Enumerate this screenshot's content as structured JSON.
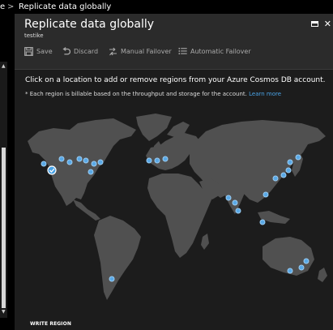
{
  "topbar": {
    "nav_glyph": "e",
    "chevron": ">",
    "breadcrumb": "Replicate data globally"
  },
  "blade": {
    "title": "Replicate data globally",
    "subtitle": "testike",
    "window_icons": [
      "maximize-icon",
      "close-icon"
    ],
    "close_glyph": "✕"
  },
  "toolbar": {
    "save_label": "Save",
    "discard_label": "Discard",
    "manual_failover_label": "Manual Failover",
    "automatic_failover_label": "Automatic Failover"
  },
  "content": {
    "instruction": "Click on a location to add or remove regions from your Azure Cosmos DB account.",
    "note": "* Each region is billable based on the throughput and storage for the account.",
    "learn_more": "Learn more",
    "write_region_label": "WRITE REGION"
  },
  "colors": {
    "accent": "#4aa3e6",
    "region_marker": "#5aa9e6",
    "selected_region": "#ffffff",
    "land": "#505050",
    "ocean": "#1c1c1c"
  },
  "scrollbar": {
    "up_glyph": "▲",
    "down_glyph": "▼"
  }
}
